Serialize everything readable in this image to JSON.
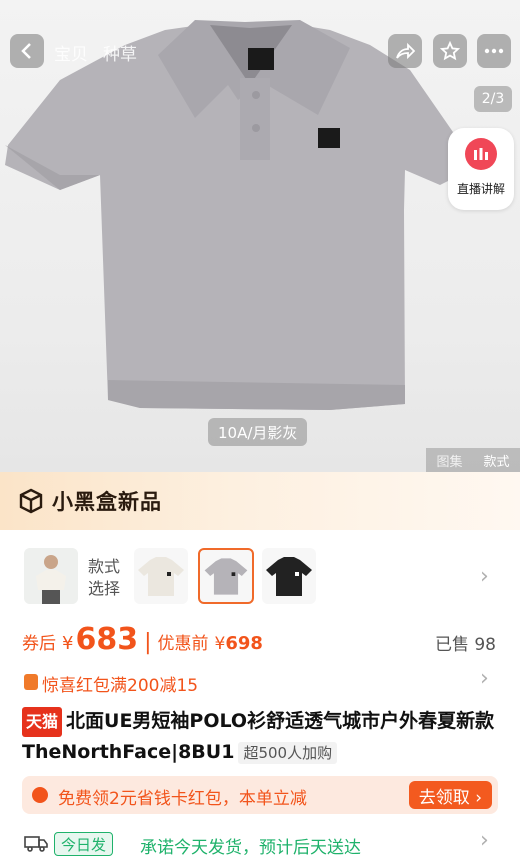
{
  "top_nav": {
    "tabs": [
      "宝贝",
      "种草"
    ],
    "page_indicator": "2/3"
  },
  "live": {
    "label": "直播讲解"
  },
  "gallery": {
    "variant_chip": "10A/月影灰",
    "tabs": [
      "图集",
      "款式"
    ]
  },
  "banner": {
    "title": "小黑盒新品"
  },
  "styles": {
    "label_line1": "款式",
    "label_line2": "选择"
  },
  "price": {
    "coupon_label": "券后",
    "yen": "¥",
    "coupon_price": "683",
    "separator": "|",
    "pre_label": "优惠前",
    "pre_price": "698",
    "sold": "已售 98"
  },
  "red_packet": {
    "text": "惊喜红包满200减15"
  },
  "product": {
    "badge": "天猫",
    "title": "北面UE男短袖POLO衫舒适透气城市户外春夏新款TheNorthFace|8BU1",
    "buyers_tag": "超500人加购"
  },
  "promo": {
    "text": "免费领2元省钱卡红包，本单立减",
    "button": "去领取 ›"
  },
  "shipping": {
    "badge": "今日发",
    "text": "承诺今天发货，预计后天送达"
  },
  "colors": {
    "accent": "#f2541b",
    "tmall_red": "#e6321c",
    "shirt_gray": "#b5b3b8",
    "green": "#1fb26b"
  }
}
